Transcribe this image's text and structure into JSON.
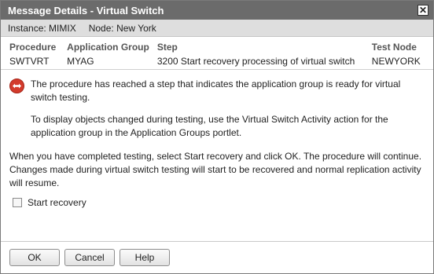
{
  "window": {
    "title": "Message Details - Virtual Switch",
    "close_glyph": "✕"
  },
  "instance_bar": {
    "instance_label": "Instance:",
    "instance_value": "MIMIX",
    "node_label": "Node:",
    "node_value": "New York"
  },
  "table": {
    "headers": [
      "Procedure",
      "Application Group",
      "Step",
      "Test Node"
    ],
    "row": [
      "SWTVRT",
      "MYAG",
      "3200 Start recovery processing of virtual switch",
      "NEWYORK"
    ]
  },
  "message": {
    "icon": "error-circle-icon",
    "paragraph1": "The procedure has reached a step that indicates the application group is ready for virtual switch testing.",
    "paragraph2": "To display objects changed during testing, use the Virtual Switch Activity action for the application group in the Application Groups portlet."
  },
  "instruction": "When you have completed testing, select Start recovery and click OK. The procedure will continue. Changes made during virtual switch testing will start to be recovered and normal replication activity will resume.",
  "start_recovery": {
    "label": "Start recovery",
    "checked": false
  },
  "buttons": {
    "ok": "OK",
    "cancel": "Cancel",
    "help": "Help"
  },
  "colors": {
    "titlebar": "#6b6b6b",
    "icon": "#d33a2b"
  }
}
